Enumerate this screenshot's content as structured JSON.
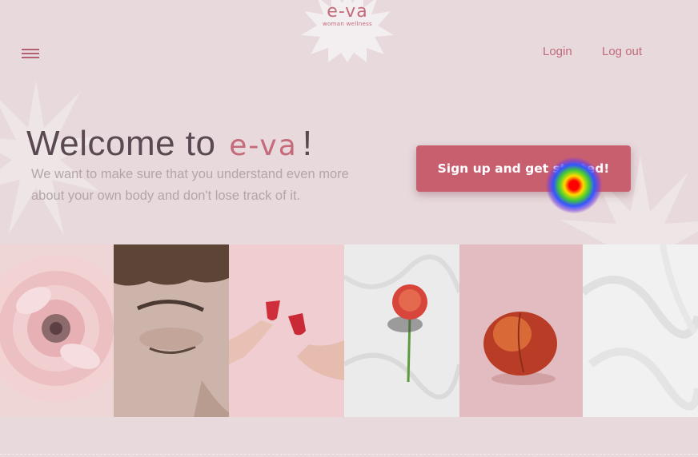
{
  "brand": {
    "logo_text": "e-va",
    "tagline": "woman wellness"
  },
  "header": {
    "menu_icon": "hamburger-icon",
    "links": [
      {
        "label": "Login"
      },
      {
        "label": "Log out"
      }
    ]
  },
  "hero": {
    "title_prefix": "Welcome to",
    "title_brand": "e-va",
    "title_suffix": "!",
    "subtitle": "We want to make sure that you understand even more about your own body and don't lose track of it.",
    "cta_label": "Sign up and get started!"
  },
  "gallery": {
    "images": [
      {
        "subject": "pink-flower"
      },
      {
        "subject": "closed-eye"
      },
      {
        "subject": "menstrual-cups"
      },
      {
        "subject": "red-flower"
      },
      {
        "subject": "peach"
      },
      {
        "subject": "white-fabric"
      }
    ]
  },
  "colors": {
    "background": "#e7d9dc",
    "accent": "#c75f6f",
    "brand": "#c56a79",
    "text": "#5a4951",
    "muted_text": "#b3a6aa"
  }
}
